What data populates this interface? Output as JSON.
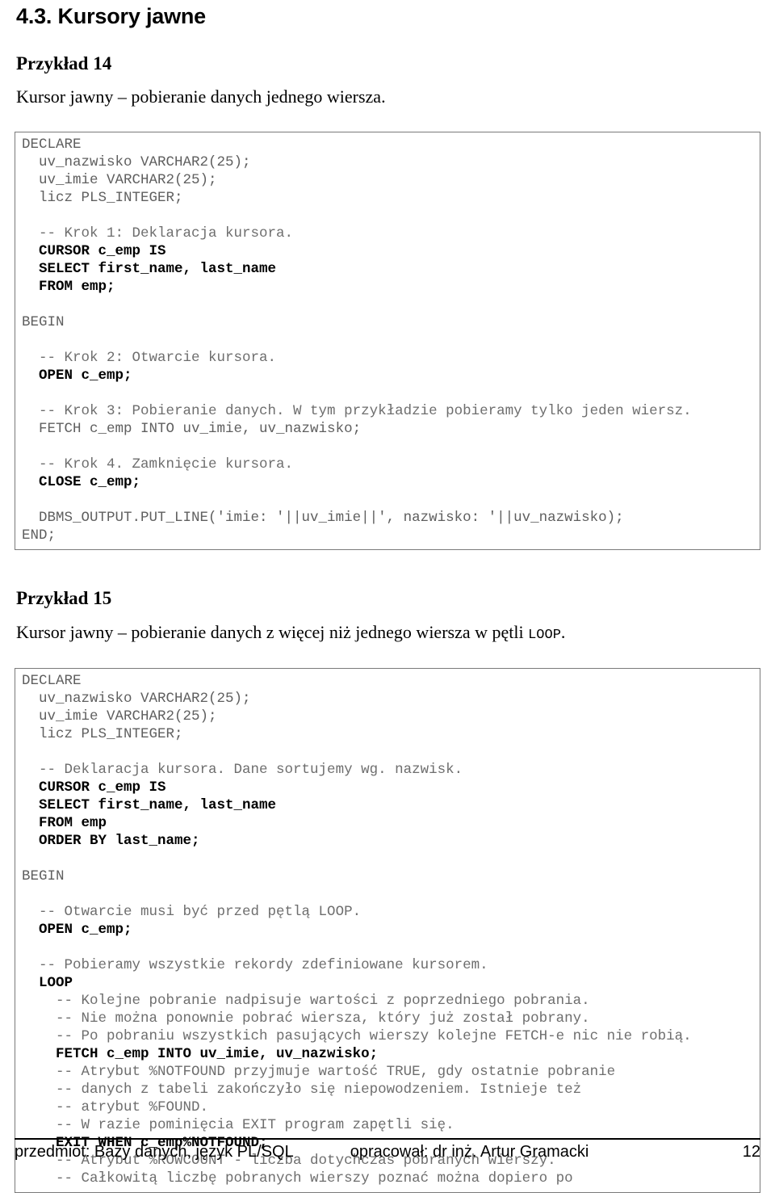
{
  "section": {
    "title": "4.3. Kursory jawne"
  },
  "example14": {
    "heading": "Przykład 14",
    "caption": "Kursor jawny – pobieranie danych jednego wiersza.",
    "code_lines": [
      [
        {
          "t": "DECLARE",
          "s": "pl"
        }
      ],
      [
        {
          "t": "  uv_nazwisko VARCHAR2(25);",
          "s": "pl"
        }
      ],
      [
        {
          "t": "  uv_imie VARCHAR2(25);",
          "s": "pl"
        }
      ],
      [
        {
          "t": "  licz PLS_INTEGER;",
          "s": "pl"
        }
      ],
      [
        {
          "t": "",
          "s": "pl"
        }
      ],
      [
        {
          "t": "  -- Krok 1: Deklaracja kursora.",
          "s": "cm"
        }
      ],
      [
        {
          "t": "  CURSOR c_emp IS",
          "s": "kw"
        }
      ],
      [
        {
          "t": "  SELECT first_name, last_name",
          "s": "kw"
        }
      ],
      [
        {
          "t": "  FROM emp;",
          "s": "kw"
        }
      ],
      [
        {
          "t": "",
          "s": "pl"
        }
      ],
      [
        {
          "t": "BEGIN",
          "s": "pl"
        }
      ],
      [
        {
          "t": "",
          "s": "pl"
        }
      ],
      [
        {
          "t": "  -- Krok 2: Otwarcie kursora.",
          "s": "cm"
        }
      ],
      [
        {
          "t": "  OPEN c_emp;",
          "s": "kw"
        }
      ],
      [
        {
          "t": "",
          "s": "pl"
        }
      ],
      [
        {
          "t": "  -- Krok 3: Pobieranie danych. W tym przykładzie pobieramy tylko jeden wiersz.",
          "s": "cm"
        }
      ],
      [
        {
          "t": "  FETCH c_emp INTO uv_imie, uv_nazwisko;",
          "s": "pl"
        }
      ],
      [
        {
          "t": "",
          "s": "pl"
        }
      ],
      [
        {
          "t": "  -- Krok 4. Zamknięcie kursora.",
          "s": "cm"
        }
      ],
      [
        {
          "t": "  CLOSE c_emp;",
          "s": "kw"
        }
      ],
      [
        {
          "t": "",
          "s": "pl"
        }
      ],
      [
        {
          "t": "  DBMS_OUTPUT.PUT_LINE('imie: '||uv_imie||', nazwisko: '||uv_nazwisko);",
          "s": "pl"
        }
      ],
      [
        {
          "t": "END;",
          "s": "pl"
        }
      ]
    ]
  },
  "example15": {
    "heading": "Przykład 15",
    "caption_before": "Kursor jawny – pobieranie danych z więcej niż jednego wiersza w pętli ",
    "caption_mono": "LOOP",
    "caption_after": ".",
    "code_lines": [
      [
        {
          "t": "DECLARE",
          "s": "pl"
        }
      ],
      [
        {
          "t": "  uv_nazwisko VARCHAR2(25);",
          "s": "pl"
        }
      ],
      [
        {
          "t": "  uv_imie VARCHAR2(25);",
          "s": "pl"
        }
      ],
      [
        {
          "t": "  licz PLS_INTEGER;",
          "s": "pl"
        }
      ],
      [
        {
          "t": "",
          "s": "pl"
        }
      ],
      [
        {
          "t": "  -- Deklaracja kursora. Dane sortujemy wg. nazwisk.",
          "s": "cm"
        }
      ],
      [
        {
          "t": "  CURSOR c_emp IS",
          "s": "kw"
        }
      ],
      [
        {
          "t": "  SELECT first_name, last_name",
          "s": "kw"
        }
      ],
      [
        {
          "t": "  FROM emp",
          "s": "kw"
        }
      ],
      [
        {
          "t": "  ORDER BY last_name;",
          "s": "kw"
        }
      ],
      [
        {
          "t": "",
          "s": "pl"
        }
      ],
      [
        {
          "t": "BEGIN",
          "s": "pl"
        }
      ],
      [
        {
          "t": "",
          "s": "pl"
        }
      ],
      [
        {
          "t": "  -- Otwarcie musi być przed pętlą LOOP.",
          "s": "cm"
        }
      ],
      [
        {
          "t": "  OPEN c_emp;",
          "s": "kw"
        }
      ],
      [
        {
          "t": "",
          "s": "pl"
        }
      ],
      [
        {
          "t": "  -- Pobieramy wszystkie rekordy zdefiniowane kursorem.",
          "s": "cm"
        }
      ],
      [
        {
          "t": "  LOOP",
          "s": "kw"
        }
      ],
      [
        {
          "t": "    -- Kolejne pobranie nadpisuje wartości z poprzedniego pobrania.",
          "s": "cm"
        }
      ],
      [
        {
          "t": "    -- Nie można ponownie pobrać wiersza, który już został pobrany.",
          "s": "cm"
        }
      ],
      [
        {
          "t": "    -- Po pobraniu wszystkich pasujących wierszy kolejne FETCH-e nic nie robią.",
          "s": "cm"
        }
      ],
      [
        {
          "t": "    FETCH c_emp INTO uv_imie, uv_nazwisko;",
          "s": "kw"
        }
      ],
      [
        {
          "t": "    -- Atrybut %NOTFOUND przyjmuje wartość TRUE, gdy ostatnie pobranie",
          "s": "cm"
        }
      ],
      [
        {
          "t": "    -- danych z tabeli zakończyło się niepowodzeniem. Istnieje też",
          "s": "cm"
        }
      ],
      [
        {
          "t": "    -- atrybut %FOUND.",
          "s": "cm"
        }
      ],
      [
        {
          "t": "    -- W razie pominięcia EXIT program zapętli się.",
          "s": "cm"
        }
      ],
      [
        {
          "t": "    EXIT WHEN c_emp%NOTFOUND;",
          "s": "kw"
        }
      ],
      [
        {
          "t": "    -- Atrybut %ROWCOUNT - liczba dotychczas pobranych wierszy.",
          "s": "cm"
        }
      ],
      [
        {
          "t": "    -- Całkowitą liczbę pobranych wierszy poznać można dopiero po",
          "s": "cm"
        }
      ]
    ]
  },
  "footer": {
    "left": "przedmiot: Bazy danych, język PL/SQL",
    "middle": "opracował: dr inż. Artur Gramacki",
    "page": "12"
  }
}
